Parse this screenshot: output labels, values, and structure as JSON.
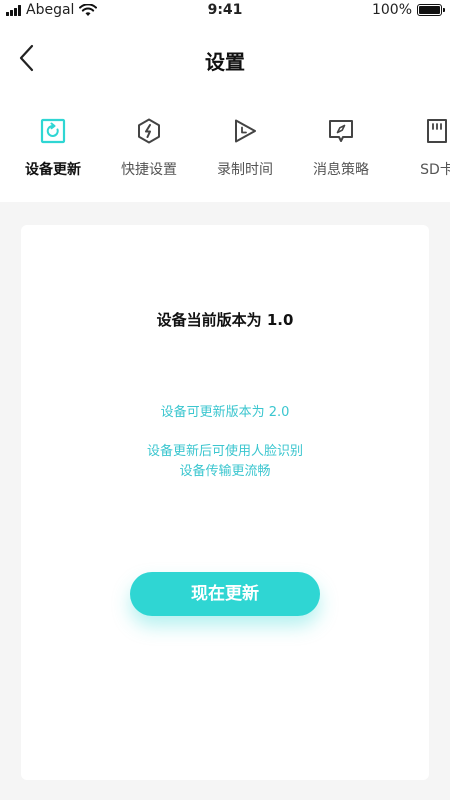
{
  "status_bar": {
    "carrier": "Abegal",
    "time": "9:41",
    "battery": "100%"
  },
  "header": {
    "title": "设置"
  },
  "tabs": [
    {
      "label": "设备更新",
      "icon": "refresh-icon",
      "active": true
    },
    {
      "label": "快捷设置",
      "icon": "bolt-icon",
      "active": false
    },
    {
      "label": "录制时间",
      "icon": "play-clock-icon",
      "active": false
    },
    {
      "label": "消息策略",
      "icon": "compass-message-icon",
      "active": false
    },
    {
      "label": "SD卡",
      "icon": "sd-card-icon",
      "active": false
    }
  ],
  "update": {
    "current_version": "设备当前版本为 1.0",
    "available_version": "设备可更新版本为 2.0",
    "benefit_line_1": "设备更新后可使用人脸识别",
    "benefit_line_2": "设备传输更流畅",
    "button_label": "现在更新"
  },
  "colors": {
    "accent": "#2fd6d3",
    "accent_text": "#3bc6cf",
    "background": "#f5f5f5"
  }
}
